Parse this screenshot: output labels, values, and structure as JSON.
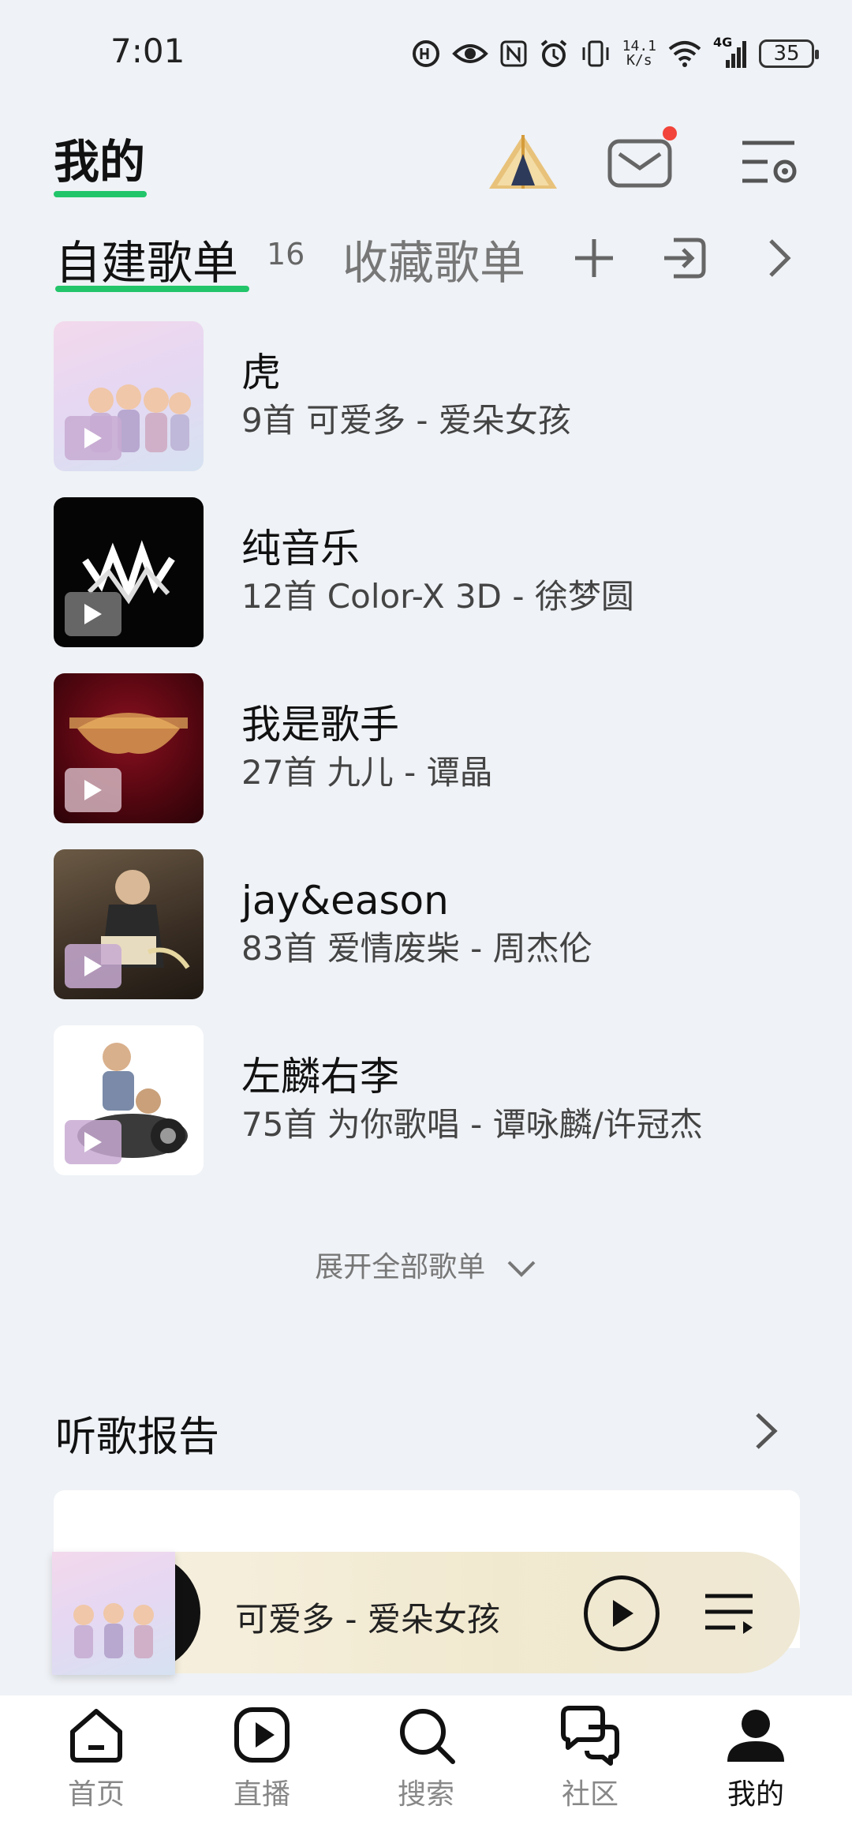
{
  "status_bar": {
    "time": "7:01",
    "net_speed_value": "14.1",
    "net_speed_unit": "K/s",
    "network": "4G",
    "battery": "35",
    "icons": [
      "hd-voice-icon",
      "eye-icon",
      "nfc-icon",
      "alarm-icon",
      "vibrate-icon",
      "wifi-icon",
      "signal-icon",
      "battery-icon"
    ]
  },
  "header": {
    "title": "我的",
    "icons": [
      "camp-tent-icon",
      "mail-icon",
      "settings-menu-icon"
    ],
    "mail_badge_color": "#f2443a"
  },
  "tabs": {
    "owned_label": "自建歌单",
    "owned_count": "16",
    "collected_label": "收藏歌单",
    "icons": [
      "add-icon",
      "import-icon",
      "chevron-right-icon"
    ]
  },
  "playlists": [
    {
      "name": "虎",
      "meta": "9首 可爱多 - 爱朵女孩"
    },
    {
      "name": "纯音乐",
      "meta": "12首 Color-X 3D - 徐梦圆"
    },
    {
      "name": "我是歌手",
      "meta": "27首 九儿 - 谭晶"
    },
    {
      "name": "jay&eason",
      "meta": "83首 爱情废柴 - 周杰伦"
    },
    {
      "name": "左麟右李",
      "meta": "75首 为你歌唱 - 谭咏麟/许冠杰"
    }
  ],
  "expand_all_label": "展开全部歌单",
  "listening_report": {
    "title": "听歌报告"
  },
  "mini_player": {
    "track": "可爱多 - 爱朵女孩",
    "icons": [
      "play-icon",
      "queue-icon"
    ]
  },
  "bottom_nav": [
    {
      "label": "首页",
      "icon": "home-icon"
    },
    {
      "label": "直播",
      "icon": "live-icon"
    },
    {
      "label": "搜索",
      "icon": "search-icon"
    },
    {
      "label": "社区",
      "icon": "community-icon"
    },
    {
      "label": "我的",
      "icon": "profile-icon",
      "active": true
    }
  ],
  "colors": {
    "accent": "#22c56a",
    "background": "#eff2f6"
  }
}
